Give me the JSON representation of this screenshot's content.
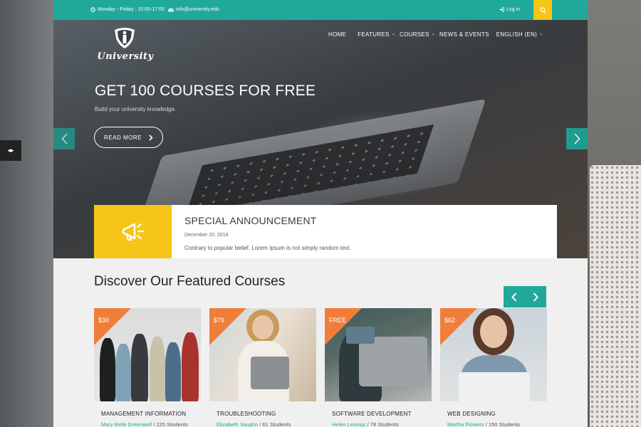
{
  "side_tab": {
    "icon": "arrows-icon"
  },
  "topbar": {
    "hours": "Monday - Friday : 10:00-17:00",
    "email": "info@university.edu",
    "login": "Log in"
  },
  "logo": {
    "text": "University"
  },
  "nav": [
    {
      "label": "HOME",
      "dropdown": false
    },
    {
      "label": "FEATURES",
      "dropdown": true
    },
    {
      "label": "COURSES",
      "dropdown": true
    },
    {
      "label": "NEWS & EVENTS",
      "dropdown": false
    },
    {
      "label": "ENGLISH (EN)",
      "dropdown": true
    }
  ],
  "hero": {
    "title": "GET 100 COURSES FOR FREE",
    "subtitle": "Build your university knowledge.",
    "button": "READ MORE"
  },
  "announcement": {
    "title": "SPECIAL ANNOUNCEMENT",
    "date": "December 20, 2018",
    "text": "Contrary to popular belief, Lorem Ipsum is not simply random text."
  },
  "featured": {
    "title": "Discover Our Featured Courses",
    "courses": [
      {
        "price": "$30",
        "name": "MANAGEMENT INFORMATION",
        "teacher": "Mary Belle Greenwell",
        "students": "225 Students"
      },
      {
        "price": "$79",
        "name": "TROUBLESHOOTING",
        "teacher": "Elizabeth Vaughn",
        "students": "61 Students"
      },
      {
        "price": "FREE",
        "name": "SOFTWARE DEVELOPMENT",
        "teacher": "Helen Levings",
        "students": "78 Students"
      },
      {
        "price": "$62",
        "name": "WEB DESIGNING",
        "teacher": "Martha Flowers",
        "students": "150 Students"
      }
    ]
  },
  "colors": {
    "accent": "#20a99a",
    "yellow": "#f5c518",
    "price": "#f07e3a"
  }
}
